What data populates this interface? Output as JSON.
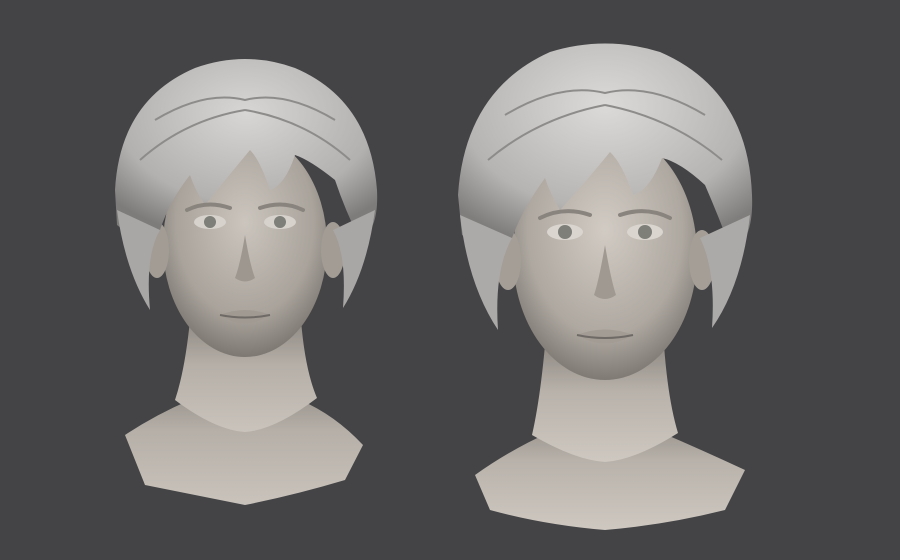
{
  "scene": {
    "background_color": "#444446",
    "skin_color": "#b9b3ac",
    "skin_shadow_color": "#8f8983",
    "hair_color": "#c7c5c3",
    "hair_shadow_color": "#8e8c8a",
    "eye_iris_color": "#7d7f78",
    "models": [
      {
        "id": "bust-left",
        "description_icon": "sculpted-female-head-bust"
      },
      {
        "id": "bust-right",
        "description_icon": "sculpted-female-head-bust"
      }
    ]
  }
}
